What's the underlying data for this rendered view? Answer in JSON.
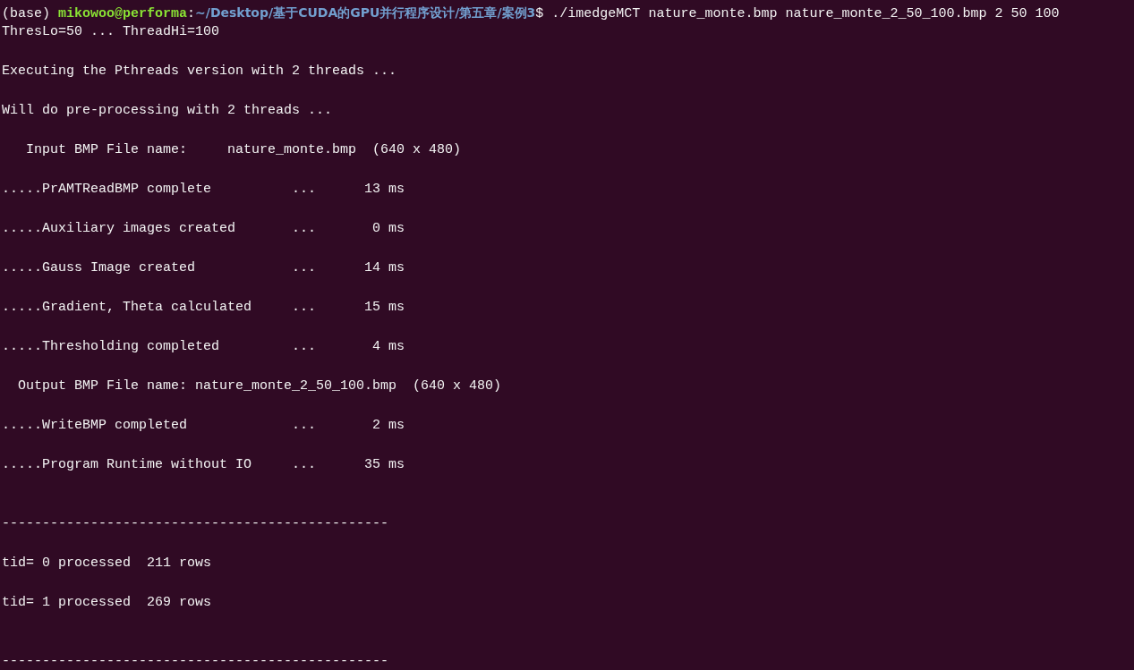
{
  "prompt": {
    "env": "(base)",
    "user_host": "mikowoo@performa",
    "separator": ":",
    "path": "~/Desktop/基于CUDA的GPU并行程序设计/第五章/案例3",
    "symbol": "$",
    "command": "./imedgeMCT nature_monte.bmp nature_monte_2_50_100.bmp 2 50 100"
  },
  "lines": [
    {
      "kind": "text",
      "text": "ThresLo=50 ... ThreadHi=100"
    },
    {
      "kind": "blank"
    },
    {
      "kind": "text",
      "text": "Executing the Pthreads version with 2 threads ..."
    },
    {
      "kind": "blank"
    },
    {
      "kind": "text",
      "text": "Will do pre-processing with 2 threads ..."
    },
    {
      "kind": "blank"
    },
    {
      "kind": "text",
      "text": "   Input BMP File name:     nature_monte.bmp  (640 x 480)"
    },
    {
      "kind": "blank"
    },
    {
      "kind": "text",
      "text": ".....PrAMTReadBMP complete          ...      13 ms"
    },
    {
      "kind": "blank"
    },
    {
      "kind": "text",
      "text": ".....Auxiliary images created       ...       0 ms"
    },
    {
      "kind": "blank"
    },
    {
      "kind": "text",
      "text": ".....Gauss Image created            ...      14 ms"
    },
    {
      "kind": "blank"
    },
    {
      "kind": "text",
      "text": ".....Gradient, Theta calculated     ...      15 ms"
    },
    {
      "kind": "blank"
    },
    {
      "kind": "text",
      "text": ".....Thresholding completed         ...       4 ms"
    },
    {
      "kind": "blank"
    },
    {
      "kind": "text",
      "text": "  Output BMP File name: nature_monte_2_50_100.bmp  (640 x 480)"
    },
    {
      "kind": "blank"
    },
    {
      "kind": "text",
      "text": ".....WriteBMP completed             ...       2 ms"
    },
    {
      "kind": "blank"
    },
    {
      "kind": "text",
      "text": ".....Program Runtime without IO     ...      35 ms"
    },
    {
      "kind": "blank"
    },
    {
      "kind": "blank"
    },
    {
      "kind": "text",
      "text": "------------------------------------------------"
    },
    {
      "kind": "blank"
    },
    {
      "kind": "text",
      "text": "tid= 0 processed  211 rows"
    },
    {
      "kind": "blank"
    },
    {
      "kind": "text",
      "text": "tid= 1 processed  269 rows"
    },
    {
      "kind": "blank"
    },
    {
      "kind": "blank"
    },
    {
      "kind": "text",
      "text": "------------------------------------------------"
    }
  ]
}
